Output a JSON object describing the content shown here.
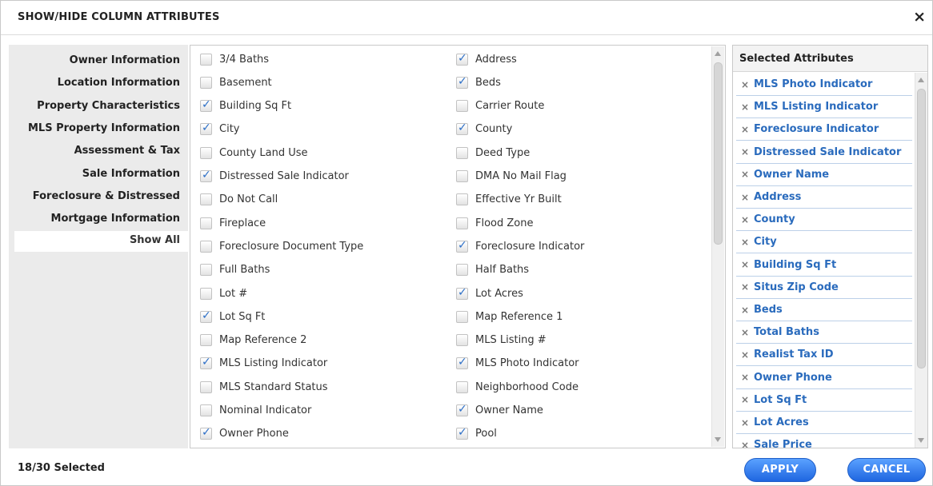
{
  "dialog": {
    "title": "SHOW/HIDE COLUMN ATTRIBUTES",
    "close_label": "×"
  },
  "nav": {
    "items": [
      {
        "label": "Owner Information"
      },
      {
        "label": "Location Information"
      },
      {
        "label": "Property Characteristics"
      },
      {
        "label": "MLS Property Information"
      },
      {
        "label": "Assessment & Tax"
      },
      {
        "label": "Sale Information"
      },
      {
        "label": "Foreclosure & Distressed"
      },
      {
        "label": "Mortgage Information"
      },
      {
        "label": "Show All",
        "active": true
      }
    ]
  },
  "attributes": {
    "col1": [
      {
        "label": "3/4 Baths",
        "checked": false
      },
      {
        "label": "Basement",
        "checked": false
      },
      {
        "label": "Building Sq Ft",
        "checked": true
      },
      {
        "label": "City",
        "checked": true
      },
      {
        "label": "County Land Use",
        "checked": false
      },
      {
        "label": "Distressed Sale Indicator",
        "checked": true
      },
      {
        "label": "Do Not Call",
        "checked": false
      },
      {
        "label": "Fireplace",
        "checked": false
      },
      {
        "label": "Foreclosure Document Type",
        "checked": false
      },
      {
        "label": "Full Baths",
        "checked": false
      },
      {
        "label": "Lot #",
        "checked": false
      },
      {
        "label": "Lot Sq Ft",
        "checked": true
      },
      {
        "label": "Map Reference 2",
        "checked": false
      },
      {
        "label": "MLS Listing Indicator",
        "checked": true
      },
      {
        "label": "MLS Standard Status",
        "checked": false
      },
      {
        "label": "Nominal Indicator",
        "checked": false
      },
      {
        "label": "Owner Phone",
        "checked": true
      }
    ],
    "col2": [
      {
        "label": "Address",
        "checked": true
      },
      {
        "label": "Beds",
        "checked": true
      },
      {
        "label": "Carrier Route",
        "checked": false
      },
      {
        "label": "County",
        "checked": true
      },
      {
        "label": "Deed Type",
        "checked": false
      },
      {
        "label": "DMA No Mail Flag",
        "checked": false
      },
      {
        "label": "Effective Yr Built",
        "checked": false
      },
      {
        "label": "Flood Zone",
        "checked": false
      },
      {
        "label": "Foreclosure Indicator",
        "checked": true
      },
      {
        "label": "Half Baths",
        "checked": false
      },
      {
        "label": "Lot Acres",
        "checked": true
      },
      {
        "label": "Map Reference 1",
        "checked": false
      },
      {
        "label": "MLS Listing #",
        "checked": false
      },
      {
        "label": "MLS Photo Indicator",
        "checked": true
      },
      {
        "label": "Neighborhood Code",
        "checked": false
      },
      {
        "label": "Owner Name",
        "checked": true
      },
      {
        "label": "Pool",
        "checked": true
      }
    ]
  },
  "selected": {
    "header": "Selected Attributes",
    "remove_glyph": "×",
    "items": [
      "MLS Photo Indicator",
      "MLS Listing Indicator",
      "Foreclosure Indicator",
      "Distressed Sale Indicator",
      "Owner Name",
      "Address",
      "County",
      "City",
      "Building Sq Ft",
      "Situs Zip Code",
      "Beds",
      "Total Baths",
      "Realist Tax ID",
      "Owner Phone",
      "Lot Sq Ft",
      "Lot Acres",
      "Sale Price"
    ]
  },
  "footer": {
    "selected_count": "18/30 Selected",
    "apply_label": "APPLY",
    "cancel_label": "CANCEL"
  },
  "colors": {
    "accent": "#2a6bbd",
    "button": "#1f66e0",
    "nav_bg": "#ebebeb"
  }
}
